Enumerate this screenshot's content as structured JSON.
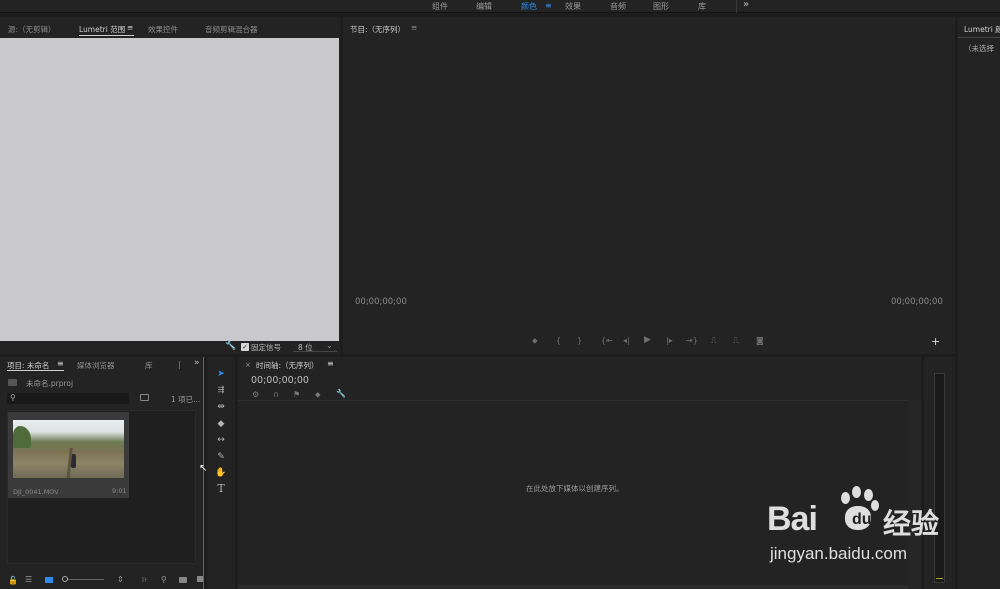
{
  "workspaces": {
    "items": [
      "组件",
      "编辑",
      "颜色",
      "效果",
      "音频",
      "图形",
      "库"
    ],
    "active_index": 2,
    "more_glyph": "»",
    "menu_glyph": "≡"
  },
  "source_panel": {
    "tabs": [
      "源:（无剪辑）",
      "Lumetri 范围",
      "效果控件",
      "音频剪辑混合器"
    ],
    "active_tab": 1,
    "clamp_label": "固定信号",
    "clamp_checked": true,
    "bit_depth": "8 位"
  },
  "program_panel": {
    "title": "节目:（无序列）",
    "timecode_left": "00;00;00;00",
    "timecode_right": "00;00;00;00"
  },
  "lumetri_panel": {
    "title": "Lumetri 颜",
    "subtitle": "（未选择"
  },
  "project_panel": {
    "tabs": [
      "项目: 未命名",
      "媒体浏览器",
      "库"
    ],
    "project_file": "未命名.prproj",
    "item_count": "1 项已...",
    "clip": {
      "name": "DJI_0041.MOV",
      "duration": "9:01"
    }
  },
  "timeline_panel": {
    "title": "时间轴:（无序列）",
    "timecode": "00;00;00;00",
    "drop_hint": "在此处放下媒体以创建序列。"
  },
  "watermark": {
    "brand": "Bai",
    "brand_cn": "经验",
    "url": "jingyan.baidu.com"
  },
  "colors": {
    "accent": "#2d8ceb",
    "panel": "#232323",
    "bg": "#1d1d1d",
    "monitor": "#c9c9cb"
  }
}
